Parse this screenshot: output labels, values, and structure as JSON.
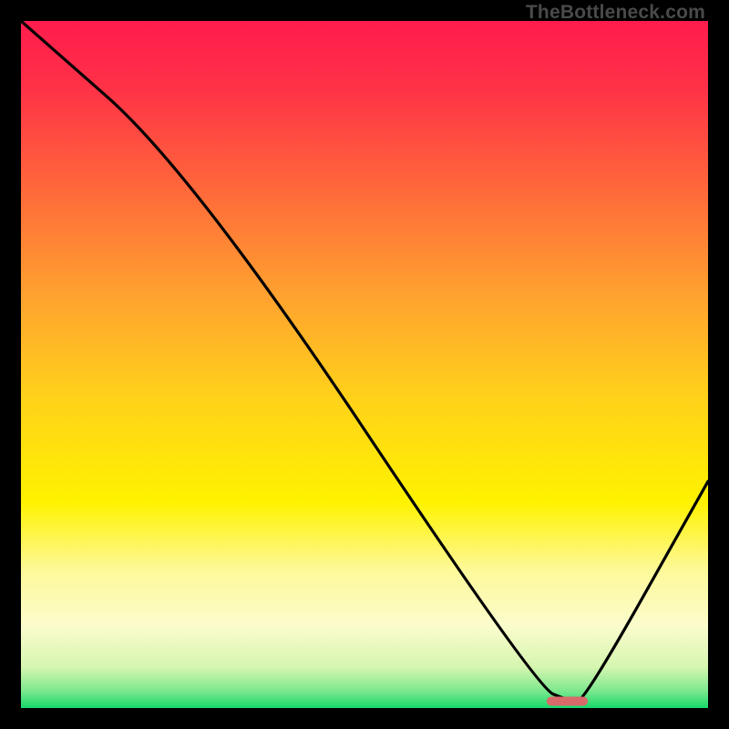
{
  "watermark": "TheBottleneck.com",
  "chart_data": {
    "type": "line",
    "title": "",
    "xlabel": "",
    "ylabel": "",
    "xlim": [
      0,
      100
    ],
    "ylim": [
      0,
      100
    ],
    "grid": false,
    "legend": false,
    "annotations": [],
    "series": [
      {
        "name": "bottleneck-curve",
        "x": [
          0,
          25,
          75,
          80,
          82,
          100
        ],
        "values": [
          100,
          78,
          3,
          1,
          1,
          33
        ]
      }
    ],
    "marker": {
      "x_start": 76.5,
      "x_end": 82.5,
      "y": 1,
      "color": "#d86a6a"
    },
    "gradient_stops": [
      {
        "offset": 0.0,
        "color": "#ff1c4d"
      },
      {
        "offset": 0.1,
        "color": "#ff3247"
      },
      {
        "offset": 0.25,
        "color": "#ff6a3a"
      },
      {
        "offset": 0.4,
        "color": "#ffa22f"
      },
      {
        "offset": 0.55,
        "color": "#ffd21a"
      },
      {
        "offset": 0.7,
        "color": "#fff200"
      },
      {
        "offset": 0.8,
        "color": "#fdf99a"
      },
      {
        "offset": 0.88,
        "color": "#fbfccc"
      },
      {
        "offset": 0.94,
        "color": "#d6f6b0"
      },
      {
        "offset": 0.975,
        "color": "#7de88e"
      },
      {
        "offset": 1.0,
        "color": "#17d86a"
      }
    ]
  }
}
